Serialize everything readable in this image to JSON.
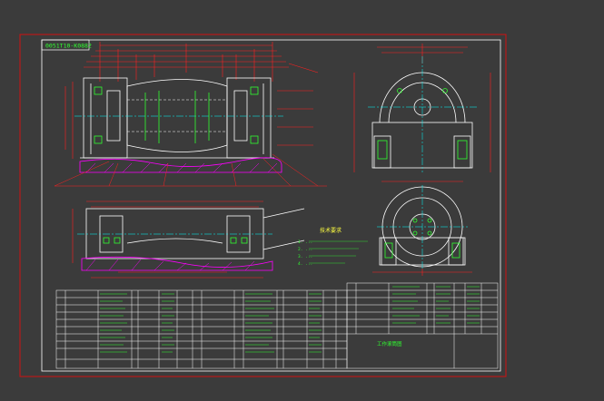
{
  "drawing": {
    "drawing_number": "0051T10-K0882",
    "title_block_label": "工作滚筒图"
  },
  "tech_requirements": {
    "heading": "技术要求",
    "items": [
      "1. ...",
      "2. ...",
      "3. ...",
      "4. ..."
    ]
  },
  "colors": {
    "background": "#3b3b3b",
    "frame_outer": "#d01010",
    "frame_inner": "#ffffff",
    "outline": "#ffffff",
    "dimension": "#ff2020",
    "center_line": "#00ffff",
    "hatch": "#ff00ff",
    "text_green": "#30ff30",
    "text_yellow": "#ffff40"
  }
}
